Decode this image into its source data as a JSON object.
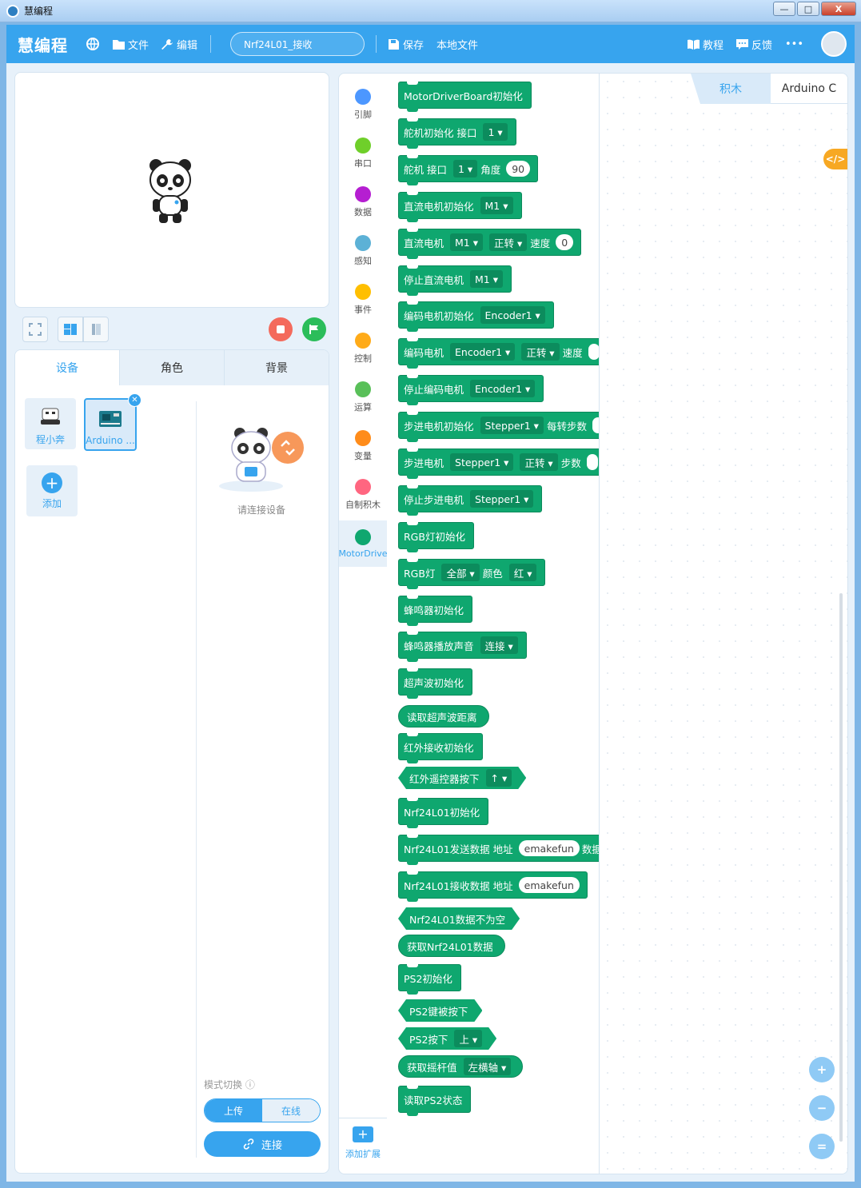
{
  "window": {
    "title": "慧编程",
    "min": "—",
    "max": "□",
    "close": "X"
  },
  "header": {
    "logo": "慧编程",
    "menu_file": "文件",
    "menu_edit": "编辑",
    "project_name": "Nrf24L01_接收",
    "save": "保存",
    "local_file": "本地文件",
    "tutorial": "教程",
    "feedback": "反馈",
    "more": "•••"
  },
  "device_panel": {
    "tabs": [
      "设备",
      "角色",
      "背景"
    ],
    "devices": [
      "程小奔",
      "Arduino ..."
    ],
    "add_label": "添加",
    "connect_hint": "请连接设备",
    "mode_label": "模式切换 ⓘ",
    "mode_upload": "上传",
    "mode_online": "在线",
    "connect_button": "连接"
  },
  "categories": [
    {
      "label": "引脚",
      "color": "#4c97ff"
    },
    {
      "label": "串口",
      "color": "#6fcf2a"
    },
    {
      "label": "数据",
      "color": "#b51ed1"
    },
    {
      "label": "感知",
      "color": "#5cb1d6"
    },
    {
      "label": "事件",
      "color": "#ffbf00"
    },
    {
      "label": "控制",
      "color": "#ffab19"
    },
    {
      "label": "运算",
      "color": "#59c059"
    },
    {
      "label": "变量",
      "color": "#ff8c1a"
    },
    {
      "label": "自制积木",
      "color": "#ff6680"
    },
    {
      "label": "MotorDrive",
      "color": "#0fa76f"
    }
  ],
  "add_extension": "添加扩展",
  "blocks": [
    {
      "shape": "stack",
      "parts": [
        {
          "t": "MotorDriverBoard初始化"
        }
      ]
    },
    {
      "shape": "stack",
      "parts": [
        {
          "t": "舵机初始化 接口"
        },
        {
          "d": "1 ▾"
        }
      ]
    },
    {
      "shape": "stack",
      "parts": [
        {
          "t": "舵机 接口"
        },
        {
          "d": "1 ▾"
        },
        {
          "t": "角度"
        },
        {
          "i": "90"
        }
      ]
    },
    {
      "shape": "stack",
      "parts": [
        {
          "t": "直流电机初始化"
        },
        {
          "d": "M1 ▾"
        }
      ]
    },
    {
      "shape": "stack",
      "parts": [
        {
          "t": "直流电机"
        },
        {
          "d": "M1 ▾"
        },
        {
          "d": "正转 ▾"
        },
        {
          "t": "速度"
        },
        {
          "i": "0"
        }
      ]
    },
    {
      "shape": "stack",
      "parts": [
        {
          "t": "停止直流电机"
        },
        {
          "d": "M1 ▾"
        }
      ]
    },
    {
      "shape": "stack",
      "parts": [
        {
          "t": "编码电机初始化"
        },
        {
          "d": "Encoder1 ▾"
        }
      ]
    },
    {
      "shape": "stack",
      "parts": [
        {
          "t": "编码电机"
        },
        {
          "d": "Encoder1 ▾"
        },
        {
          "d": "正转 ▾"
        },
        {
          "t": "速度"
        },
        {
          "i": " "
        }
      ]
    },
    {
      "shape": "stack",
      "parts": [
        {
          "t": "停止编码电机"
        },
        {
          "d": "Encoder1 ▾"
        }
      ]
    },
    {
      "shape": "stack",
      "parts": [
        {
          "t": "步进电机初始化"
        },
        {
          "d": "Stepper1 ▾"
        },
        {
          "t": "每转步数"
        },
        {
          "i": " "
        }
      ]
    },
    {
      "shape": "stack",
      "parts": [
        {
          "t": "步进电机"
        },
        {
          "d": "Stepper1 ▾"
        },
        {
          "d": "正转 ▾"
        },
        {
          "t": "步数"
        },
        {
          "i": " "
        }
      ]
    },
    {
      "shape": "stack",
      "parts": [
        {
          "t": "停止步进电机"
        },
        {
          "d": "Stepper1 ▾"
        }
      ]
    },
    {
      "shape": "stack",
      "parts": [
        {
          "t": "RGB灯初始化"
        }
      ]
    },
    {
      "shape": "stack",
      "parts": [
        {
          "t": "RGB灯"
        },
        {
          "d": "全部 ▾"
        },
        {
          "t": "颜色"
        },
        {
          "d": "红 ▾"
        }
      ]
    },
    {
      "shape": "stack",
      "parts": [
        {
          "t": "蜂鸣器初始化"
        }
      ]
    },
    {
      "shape": "stack",
      "parts": [
        {
          "t": "蜂鸣器播放声音"
        },
        {
          "d": "连接 ▾"
        }
      ]
    },
    {
      "shape": "stack",
      "parts": [
        {
          "t": "超声波初始化"
        }
      ]
    },
    {
      "shape": "rep",
      "parts": [
        {
          "t": "读取超声波距离"
        }
      ]
    },
    {
      "shape": "stack",
      "parts": [
        {
          "t": "红外接收初始化"
        }
      ]
    },
    {
      "shape": "bool",
      "parts": [
        {
          "t": "红外遥控器按下"
        },
        {
          "d": "↑ ▾"
        }
      ]
    },
    {
      "shape": "stack",
      "parts": [
        {
          "t": "Nrf24L01初始化"
        }
      ]
    },
    {
      "shape": "stack",
      "parts": [
        {
          "t": "Nrf24L01发送数据 地址"
        },
        {
          "i": "emakefun"
        },
        {
          "t": "数据"
        }
      ]
    },
    {
      "shape": "stack",
      "parts": [
        {
          "t": "Nrf24L01接收数据 地址"
        },
        {
          "i": "emakefun"
        }
      ]
    },
    {
      "shape": "bool",
      "parts": [
        {
          "t": "Nrf24L01数据不为空"
        }
      ]
    },
    {
      "shape": "rep",
      "parts": [
        {
          "t": "获取Nrf24L01数据"
        }
      ]
    },
    {
      "shape": "stack",
      "parts": [
        {
          "t": "PS2初始化"
        }
      ]
    },
    {
      "shape": "bool",
      "parts": [
        {
          "t": "PS2键被按下"
        }
      ]
    },
    {
      "shape": "bool",
      "parts": [
        {
          "t": "PS2按下"
        },
        {
          "d": "上 ▾"
        }
      ]
    },
    {
      "shape": "rep",
      "parts": [
        {
          "t": "获取摇杆值"
        },
        {
          "d": "左横轴 ▾"
        }
      ]
    },
    {
      "shape": "stack",
      "parts": [
        {
          "t": "读取PS2状态"
        }
      ]
    }
  ],
  "workspace": {
    "tab_blocks": "积木",
    "tab_code": "Arduino C",
    "code_toggle": "</>",
    "zoom_in": "+",
    "zoom_out": "−",
    "zoom_reset": "="
  }
}
